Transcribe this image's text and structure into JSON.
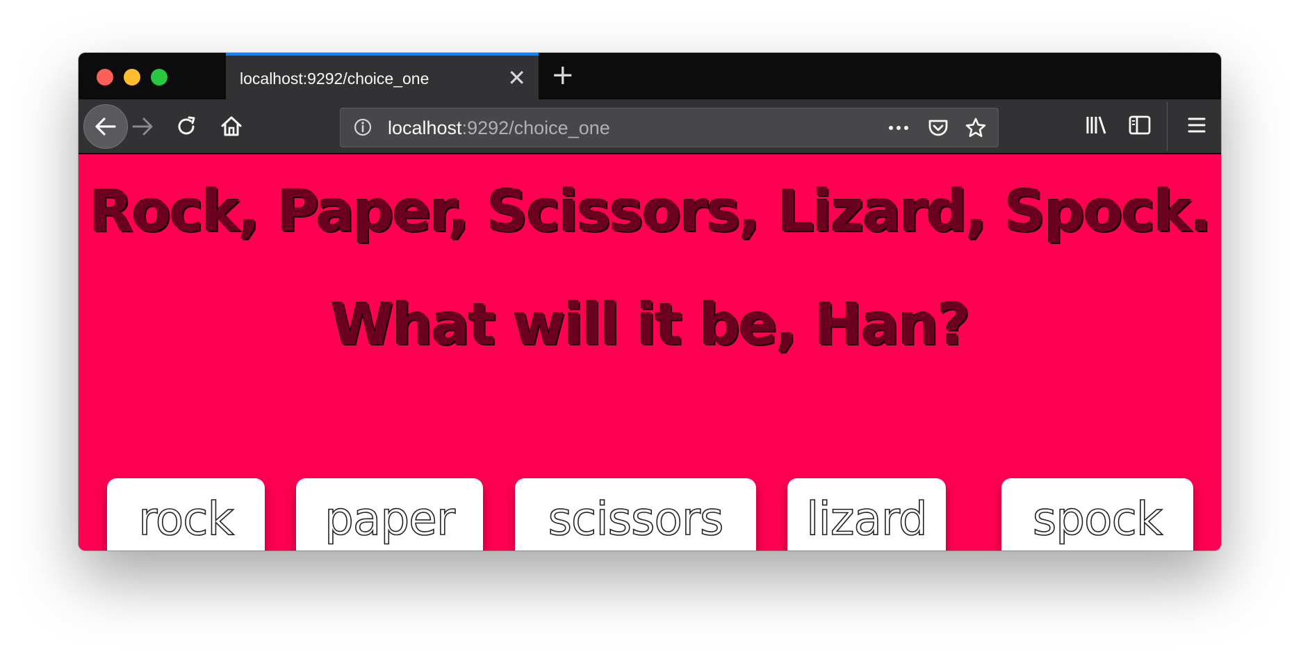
{
  "browser": {
    "tab": {
      "title": "localhost:9292/choice_one",
      "close_label": "✕"
    },
    "new_tab_label": "+",
    "url": {
      "host": "localhost",
      "rest": ":9292/choice_one"
    },
    "icons": {
      "back": "back-arrow-icon",
      "forward": "forward-arrow-icon",
      "reload": "reload-icon",
      "home": "home-icon",
      "info": "info-icon",
      "more": "more-icon",
      "pocket": "pocket-icon",
      "star": "bookmark-star-icon",
      "library": "library-icon",
      "sidebar": "sidebar-icon",
      "menu": "hamburger-menu-icon"
    },
    "colors": {
      "tabstrip": "#0c0c0d",
      "toolbar": "#323234",
      "tab_accent": "#0a84ff"
    }
  },
  "page": {
    "background": "#ff0052",
    "headline_line1": "Rock, Paper, Scissors, Lizard, Spock.",
    "headline_line2": "What will it be, Han?",
    "choices": [
      "rock",
      "paper",
      "scissors",
      "lizard",
      "spock"
    ]
  }
}
